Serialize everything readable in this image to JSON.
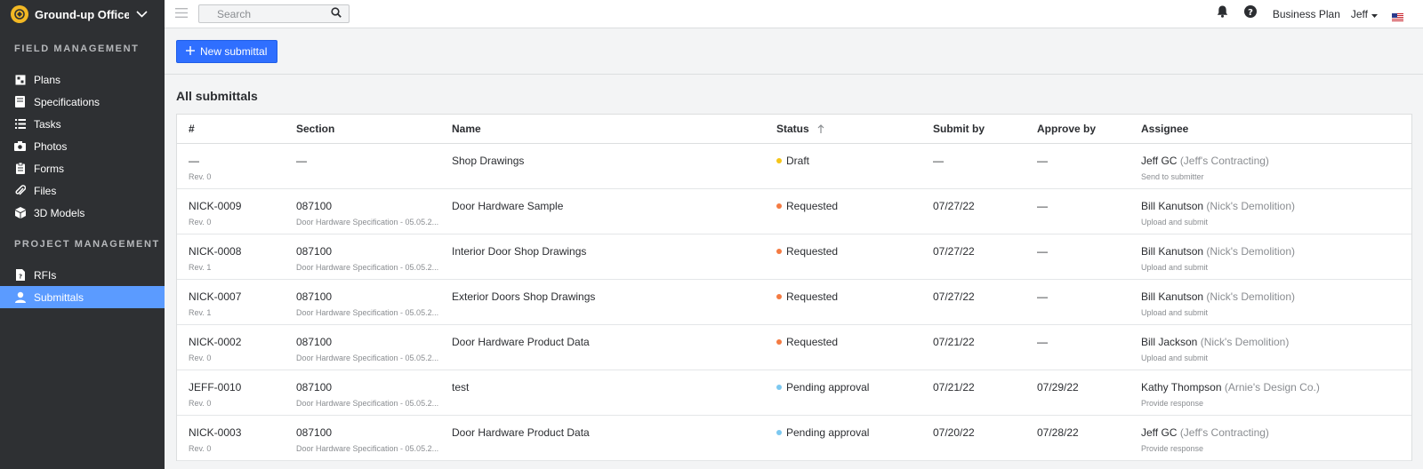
{
  "colors": {
    "sidebar_bg": "#2e3033",
    "active_nav": "#5b9bff",
    "primary_button": "#2f6fff",
    "draft": "#f5c518",
    "requested": "#f47b42",
    "pending_approval": "#7cc8f0"
  },
  "sidebar": {
    "project_name": "Ground-up Office B...",
    "field_title": "FIELD MANAGEMENT",
    "field_items": [
      {
        "label": "Plans",
        "icon": "plans-icon"
      },
      {
        "label": "Specifications",
        "icon": "specifications-icon"
      },
      {
        "label": "Tasks",
        "icon": "tasks-icon"
      },
      {
        "label": "Photos",
        "icon": "camera-icon"
      },
      {
        "label": "Forms",
        "icon": "clipboard-icon"
      },
      {
        "label": "Files",
        "icon": "paperclip-icon"
      },
      {
        "label": "3D Models",
        "icon": "cube-icon"
      }
    ],
    "project_title": "PROJECT MANAGEMENT",
    "project_items": [
      {
        "label": "RFIs",
        "icon": "rfi-icon"
      },
      {
        "label": "Submittals",
        "icon": "submittals-icon",
        "active": true
      }
    ]
  },
  "topbar": {
    "search_placeholder": "Search",
    "plan": "Business Plan",
    "user": "Jeff"
  },
  "main": {
    "new_button": "New submittal",
    "list_title": "All submittals",
    "columns": {
      "num": "#",
      "section": "Section",
      "name": "Name",
      "status": "Status",
      "submit_by": "Submit by",
      "approve_by": "Approve by",
      "assignee": "Assignee"
    },
    "rows": [
      {
        "num": "—",
        "rev": "Rev. 0",
        "section": "—",
        "section_sub": "",
        "name": "Shop Drawings",
        "status": "Draft",
        "status_color": "#f5c518",
        "submit_by": "—",
        "approve_by": "—",
        "assignee": "Jeff GC",
        "company": "(Jeff's Contracting)",
        "action": "Send to submitter"
      },
      {
        "num": "NICK-0009",
        "rev": "Rev. 0",
        "section": "087100",
        "section_sub": "Door Hardware Specification - 05.05.2...",
        "name": "Door Hardware Sample",
        "status": "Requested",
        "status_color": "#f47b42",
        "submit_by": "07/27/22",
        "approve_by": "—",
        "assignee": "Bill Kanutson",
        "company": "(Nick's Demolition)",
        "action": "Upload and submit"
      },
      {
        "num": "NICK-0008",
        "rev": "Rev. 1",
        "section": "087100",
        "section_sub": "Door Hardware Specification - 05.05.2...",
        "name": "Interior Door Shop Drawings",
        "status": "Requested",
        "status_color": "#f47b42",
        "submit_by": "07/27/22",
        "approve_by": "—",
        "assignee": "Bill Kanutson",
        "company": "(Nick's Demolition)",
        "action": "Upload and submit"
      },
      {
        "num": "NICK-0007",
        "rev": "Rev. 1",
        "section": "087100",
        "section_sub": "Door Hardware Specification - 05.05.2...",
        "name": "Exterior Doors Shop Drawings",
        "status": "Requested",
        "status_color": "#f47b42",
        "submit_by": "07/27/22",
        "approve_by": "—",
        "assignee": "Bill Kanutson",
        "company": "(Nick's Demolition)",
        "action": "Upload and submit"
      },
      {
        "num": "NICK-0002",
        "rev": "Rev. 0",
        "section": "087100",
        "section_sub": "Door Hardware Specification - 05.05.2...",
        "name": "Door Hardware Product Data",
        "status": "Requested",
        "status_color": "#f47b42",
        "submit_by": "07/21/22",
        "approve_by": "—",
        "assignee": "Bill Jackson",
        "company": "(Nick's Demolition)",
        "action": "Upload and submit"
      },
      {
        "num": "JEFF-0010",
        "rev": "Rev. 0",
        "section": "087100",
        "section_sub": "Door Hardware Specification - 05.05.2...",
        "name": "test",
        "status": "Pending approval",
        "status_color": "#7cc8f0",
        "submit_by": "07/21/22",
        "approve_by": "07/29/22",
        "assignee": "Kathy Thompson",
        "company": "(Arnie's Design Co.)",
        "action": "Provide response"
      },
      {
        "num": "NICK-0003",
        "rev": "Rev. 0",
        "section": "087100",
        "section_sub": "Door Hardware Specification - 05.05.2...",
        "name": "Door Hardware Product Data",
        "status": "Pending approval",
        "status_color": "#7cc8f0",
        "submit_by": "07/20/22",
        "approve_by": "07/28/22",
        "assignee": "Jeff GC",
        "company": "(Jeff's Contracting)",
        "action": "Provide response"
      }
    ]
  }
}
